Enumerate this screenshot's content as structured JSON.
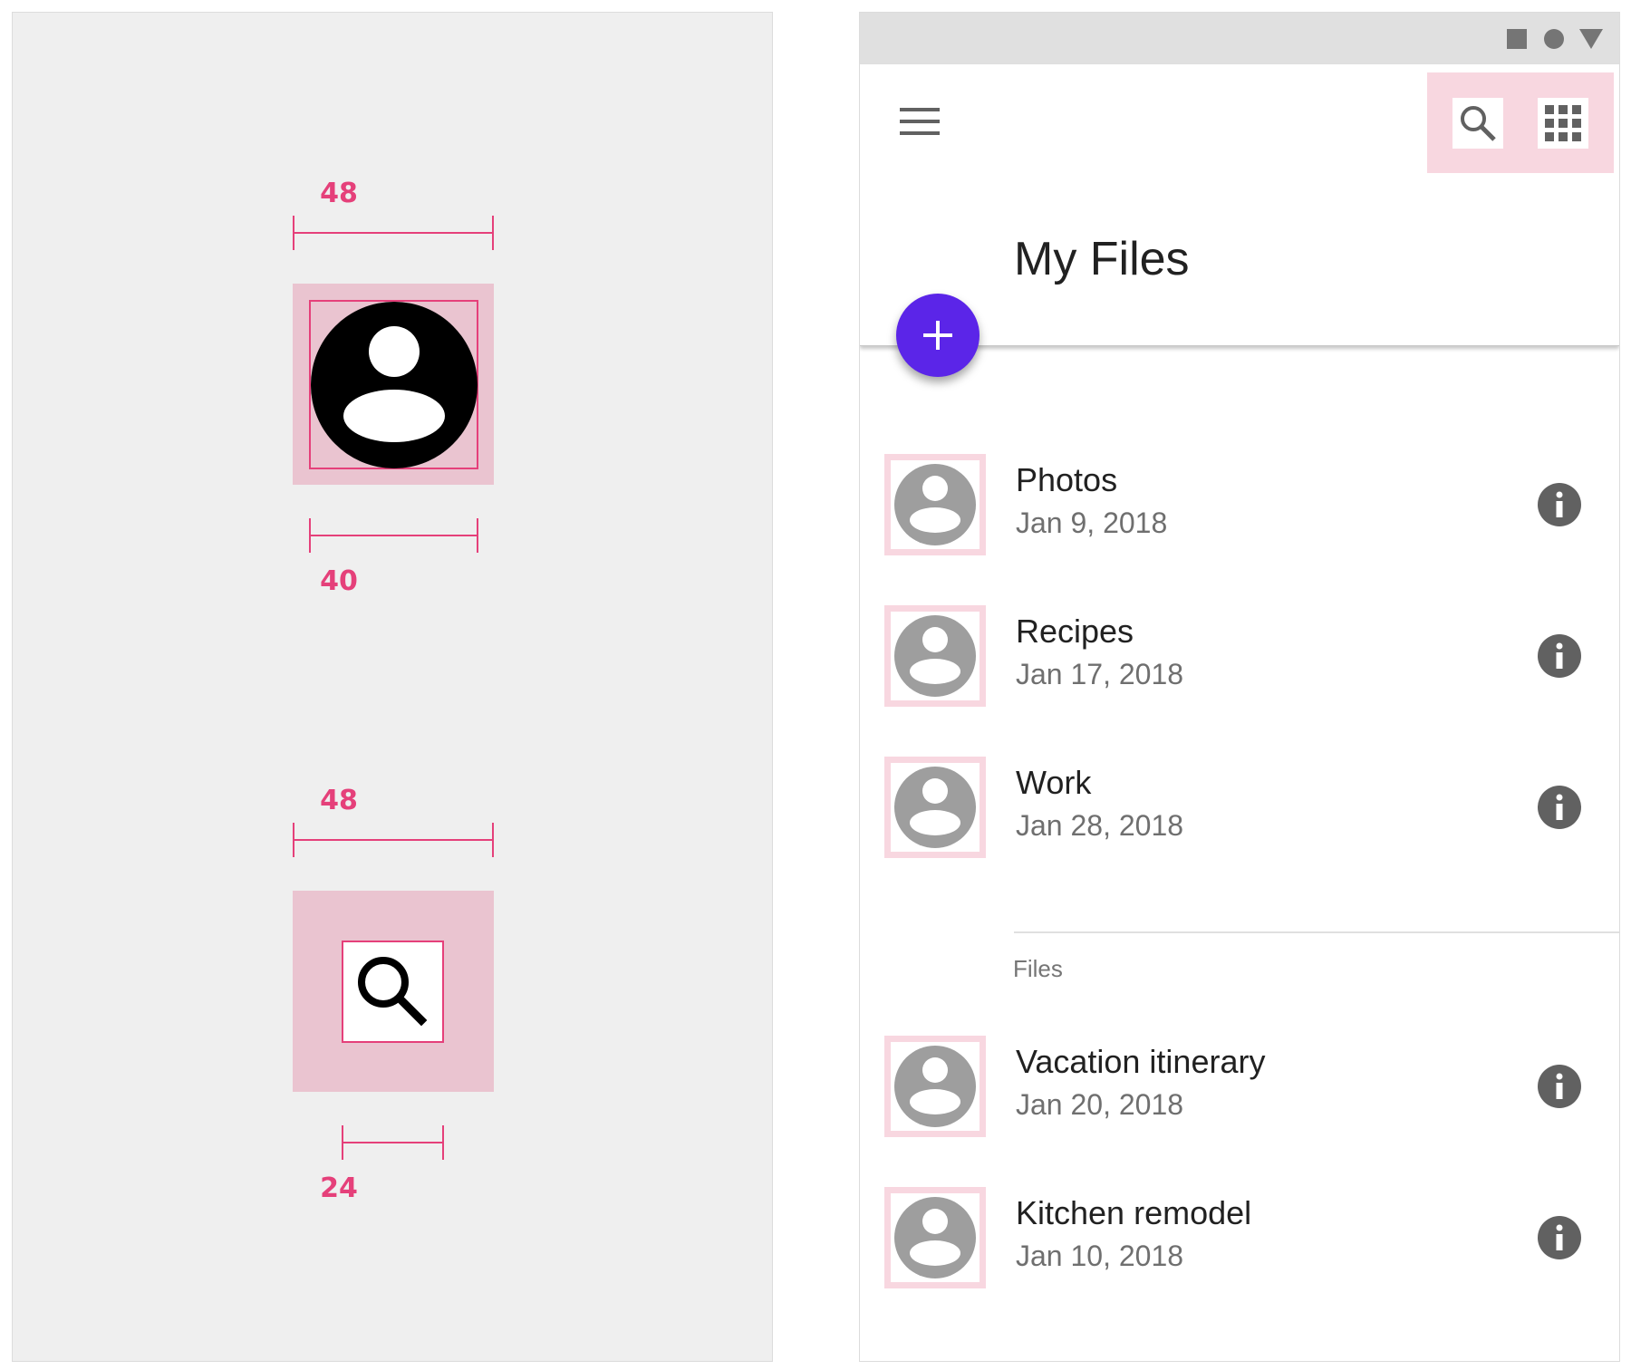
{
  "spec": {
    "avatar_touch_label": "48",
    "avatar_icon_label": "40",
    "search_touch_label": "48",
    "search_icon_label": "24",
    "accent": "#e5407a",
    "touch_target_color": "#eac4d0",
    "icons": [
      "account-circle-icon",
      "search-icon"
    ]
  },
  "phone": {
    "status_icons": [
      "square-icon",
      "circle-icon",
      "triangle-icon"
    ],
    "appbar": {
      "title": "My Files",
      "nav_icon": "menu-icon",
      "actions": [
        "search-icon",
        "apps-grid-icon"
      ]
    },
    "fab": {
      "icon": "plus-icon",
      "color": "#5b25e8"
    },
    "folders": [
      {
        "name": "Photos",
        "date": "Jan 9, 2018"
      },
      {
        "name": "Recipes",
        "date": "Jan 17, 2018"
      },
      {
        "name": "Work",
        "date": "Jan 28, 2018"
      }
    ],
    "files_header": "Files",
    "files": [
      {
        "name": "Vacation itinerary",
        "date": "Jan 20, 2018"
      },
      {
        "name": "Kitchen remodel",
        "date": "Jan 10, 2018"
      }
    ]
  }
}
